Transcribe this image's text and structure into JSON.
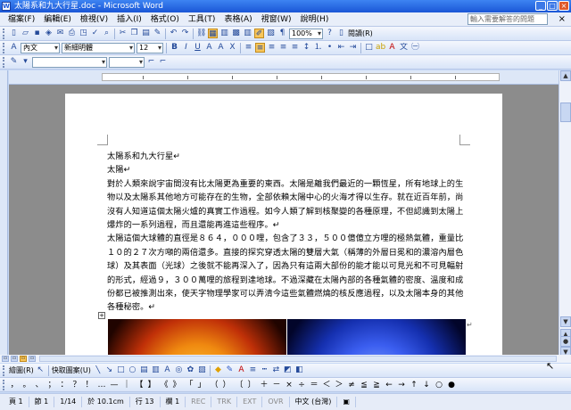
{
  "window": {
    "title": "太陽系和九大行星.doc - Microsoft Word",
    "app_icon": "W",
    "minimize": "_",
    "maximize": "□",
    "close": "×"
  },
  "menu": {
    "items": [
      "檔案(F)",
      "編輯(E)",
      "檢視(V)",
      "插入(I)",
      "格式(O)",
      "工具(T)",
      "表格(A)",
      "視窗(W)",
      "說明(H)"
    ],
    "help_placeholder": "輸入需要解答的問題",
    "close": "×"
  },
  "toolbar_standard": {
    "zoom": "100%",
    "read_label": "閱讀(R)"
  },
  "toolbar_format": {
    "style": "內文",
    "font": "新細明體",
    "size": "12"
  },
  "document": {
    "paragraphs": [
      "太陽系和九大行星↵",
      "太陽↵",
      "對於人類來說宇宙間沒有比太陽更為重要的東西。太陽是離我們最近的一顆恆星，所有地球上的生物以及太陽系其他地方可能存在的生物，全部依賴太陽中心的火海才得以生存。就在近百年前，尚沒有人知道這個太陽火爐的真實工作過程。如今人類了解到核聚變的各種原理，不但認識到太陽上爆炸的一系列過程，而且還能再進這些程序。↵",
      "太陽這個大球體的直徑是８６４，０００哩，包含了３３，５００億億立方哩的極熱氣體，重量比１０的２７次方噸的兩倍還多。直接的探究穿透太陽的雙層大氣（稱薄的外層日冕和的濃溶內層色球）及其表面（光球）之後就不能再深入了，因為只有這兩大部份的能才能以可見光和不可見輻射的形式，經過９，３００萬哩的旅程到達地球。不過深藏在太陽內部的各種氣體的密度、溫度和成份都已被推測出來，使天字物理學家可以弄清今這些氣體燃燒的核反應過程，以及太陽本身的其他各種秘密。↵"
    ]
  },
  "draw_toolbar": {
    "draw_label": "繪圖(R)",
    "autoshapes_label": "快取圖案(U)"
  },
  "symbols": [
    "，",
    "。",
    "、",
    "；",
    "：",
    "？",
    "！",
    "…",
    "—",
    "｜",
    "【",
    "】",
    "《",
    "》",
    "「",
    "」",
    "（",
    "）",
    "〔",
    "〕",
    "＋",
    "－",
    "×",
    "÷",
    "＝",
    "＜",
    "＞",
    "≠",
    "≦",
    "≧",
    "←",
    "→",
    "↑",
    "↓",
    "○",
    "●"
  ],
  "status": {
    "page": "頁 1",
    "section": "節 1",
    "pages": "1/14",
    "position": "於 10.1cm",
    "line": "行 13",
    "col": "欄 1",
    "rec": "REC",
    "trk": "TRK",
    "ext": "EXT",
    "ovr": "OVR",
    "lang": "中文 (台灣)"
  }
}
